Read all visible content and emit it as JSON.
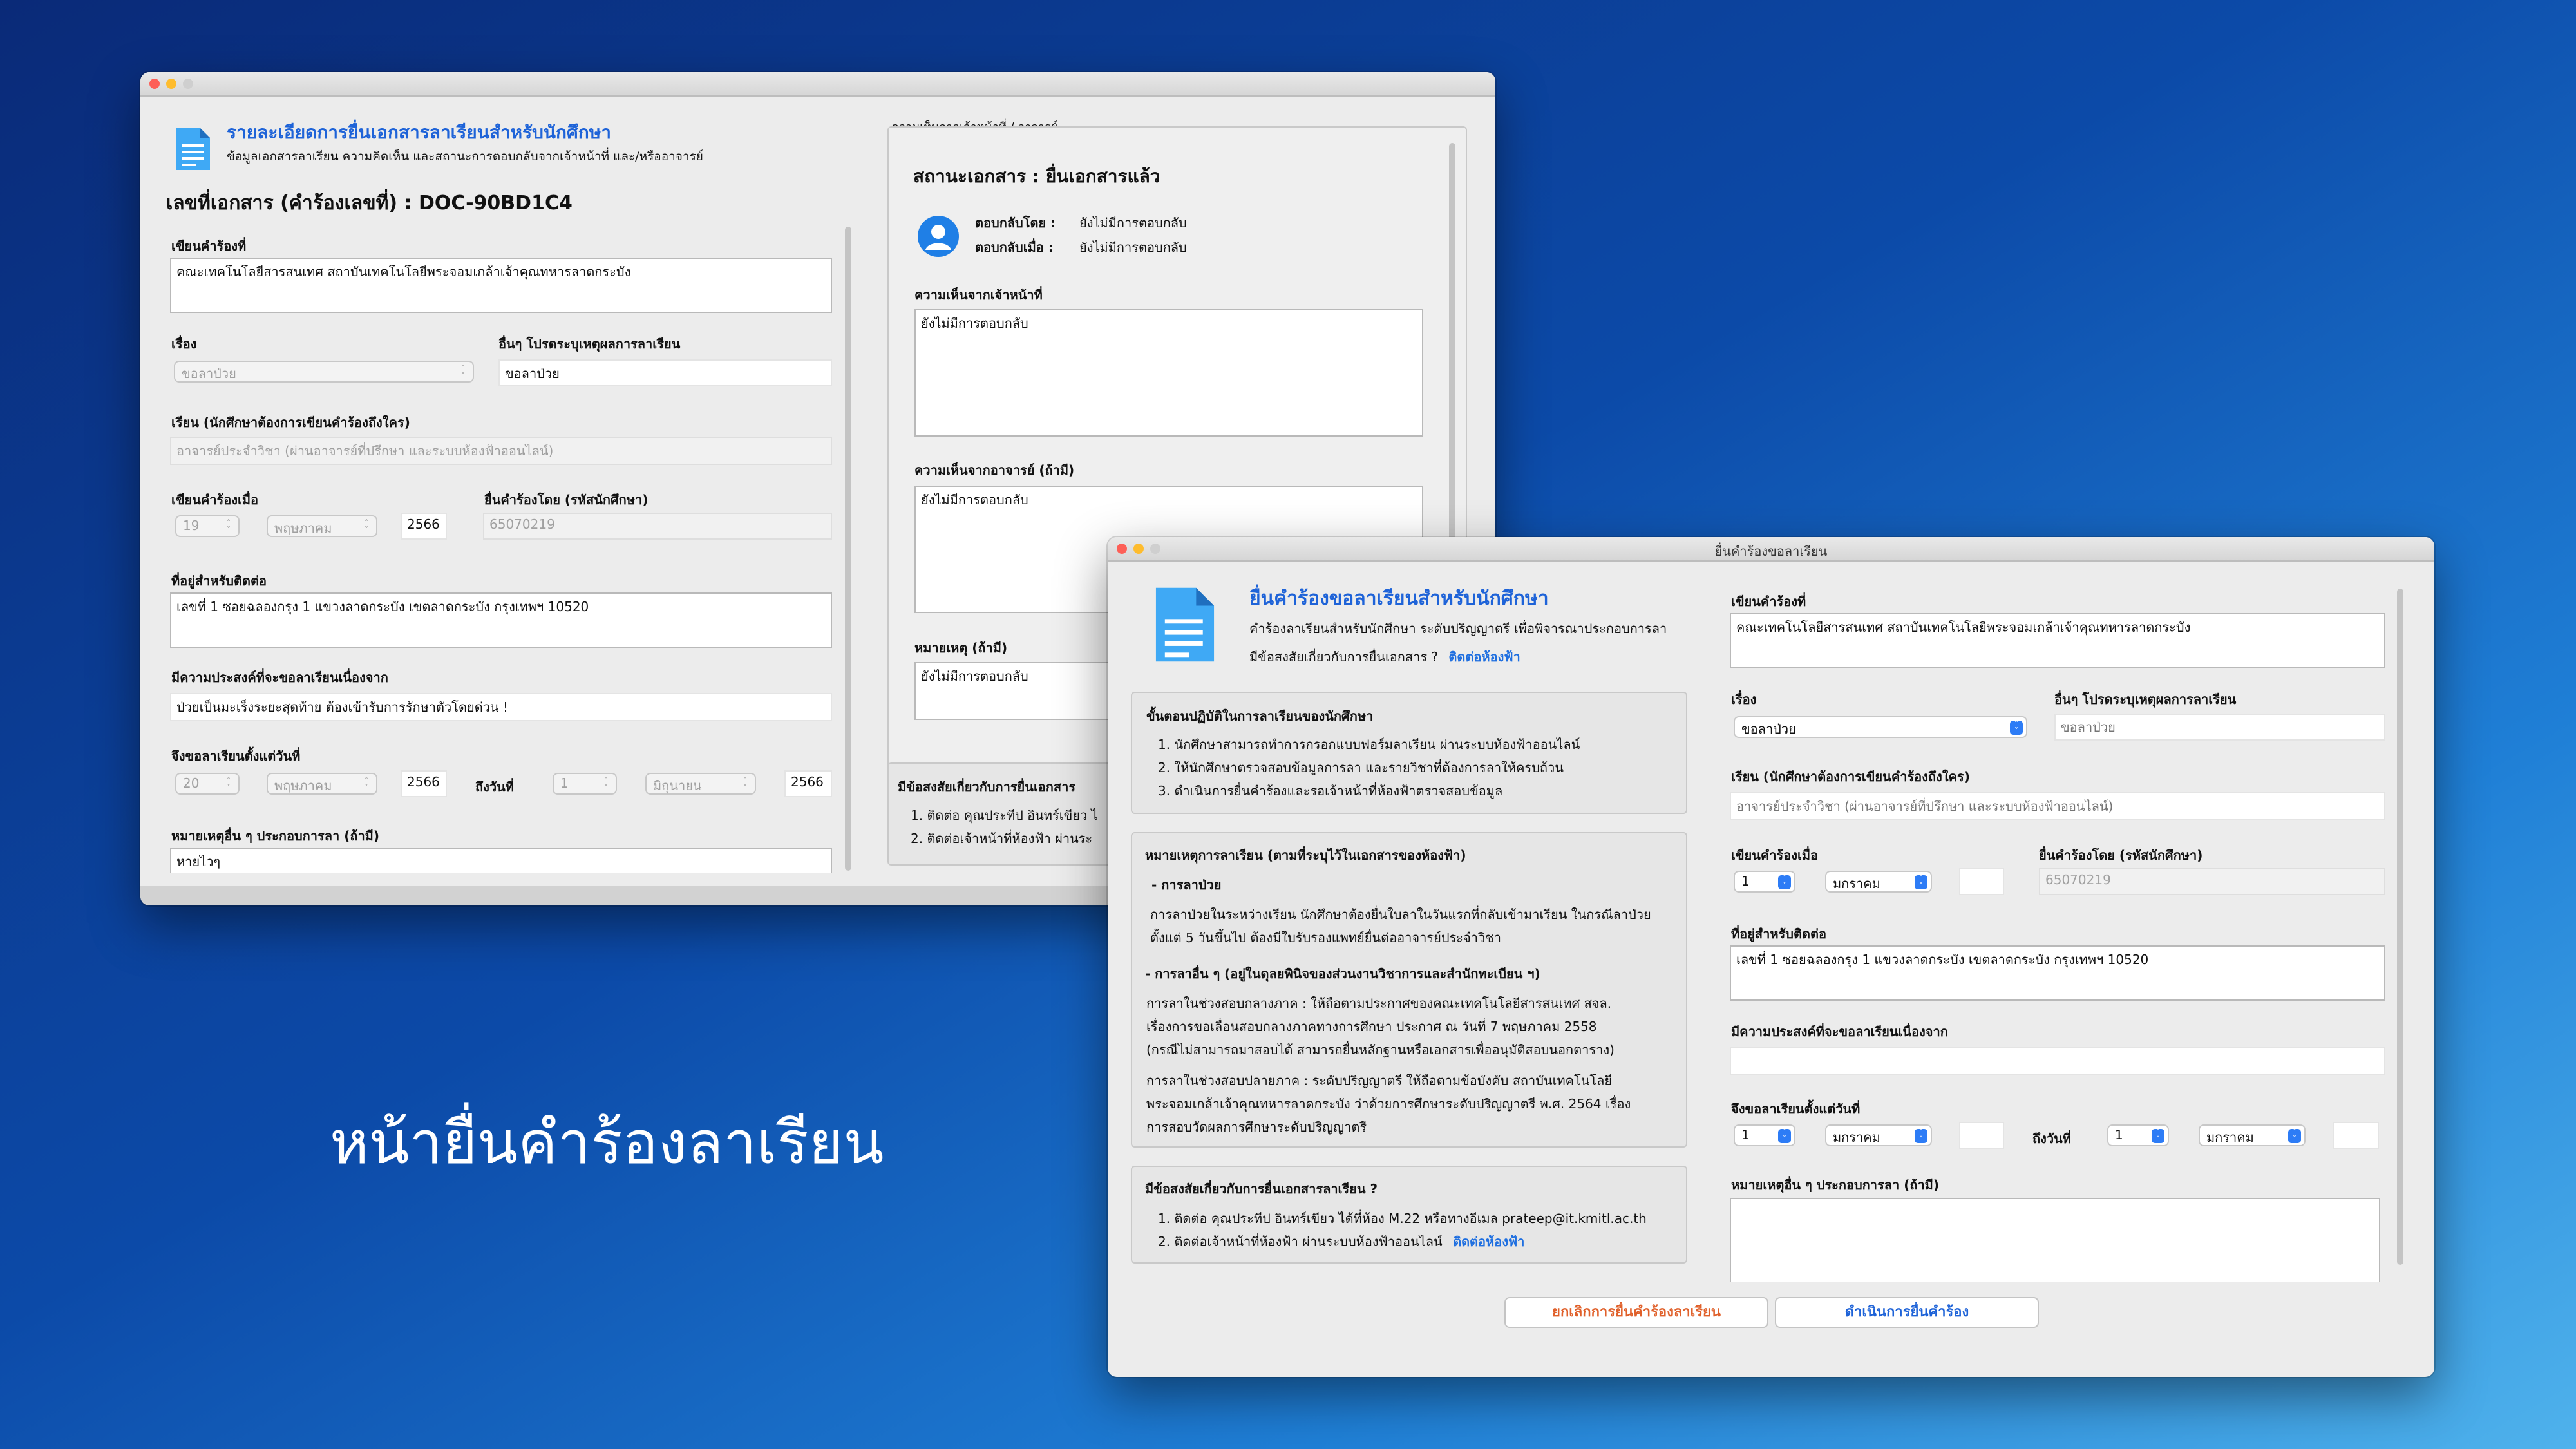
{
  "hero": {
    "text": "หน้ายื่นคำร้องลาเรียน"
  },
  "detail": {
    "title": "รายละเอียดการยื่นเอกสารลาเรียนสำหรับนักศึกษา",
    "subtitle": "ข้อมูลเอกสารลาเรียน ความคิดเห็น และสถานะการตอบกลับจากเจ้าหน้าที่ และ/หรืออาจารย์",
    "doc_id": "เลขที่เอกสาร (คำร้องเลขที่) :  DOC-90BD1C4",
    "write_at_label": "เขียนคำร้องที่",
    "write_at_value": "คณะเทคโนโลยีสารสนเทศ สถาบันเทคโนโลยีพระจอมเกล้าเจ้าคุณทหารลาดกระบัง",
    "subject_label": "เรื่อง",
    "subject_value": "ขอลาป่วย",
    "other_label": "อื่นๆ โปรดระบุเหตุผลการลาเรียน",
    "other_value": "ขอลาป่วย",
    "dear_label": "เรียน (นักศึกษาต้องการเขียนคำร้องถึงใคร)",
    "dear_value": "อาจารย์ประจำวิชา (ผ่านอาจารย์ที่ปรึกษา และระบบห้องฟ้าออนไลน์)",
    "date_label": "เขียนคำร้องเมื่อ",
    "date_day": "19",
    "date_month": "พฤษภาคม",
    "date_year": "2566",
    "by_label": "ยื่นคำร้องโดย (รหัสนักศึกษา)",
    "by_value": "65070219",
    "addr_label": "ที่อยู่สำหรับติดต่อ",
    "addr_value": "เลขที่ 1 ซอยฉลองกรุง 1 แขวงลาดกระบัง เขตลาดกระบัง กรุงเทพฯ 10520",
    "reason_label": "มีความประสงค์ที่จะขอลาเรียนเนื่องจาก",
    "reason_value": "ป่วยเป็นมะเร็งระยะสุดท้าย ต้องเข้ารับการรักษาตัวโดยด่วน !",
    "from_label": "จึงขอลาเรียนตั้งแต่วันที่",
    "from_day": "20",
    "from_month": "พฤษภาคม",
    "from_year": "2566",
    "to_label": "ถึงวันที่",
    "to_day": "1",
    "to_month": "มิถุนายน",
    "to_year": "2566",
    "note_label": "หมายเหตุอื่น ๆ ประกอบการลา (ถ้ามี)",
    "note_value": "หายไวๆ",
    "comment_group": "ความเห็นจากเจ้าหน้าที่ / อาจารย์",
    "status": "สถานะเอกสาร :  ยื่นเอกสารแล้ว",
    "reply_by_label": "ตอบกลับโดย :",
    "reply_by_value": "ยังไม่มีการตอบกลับ",
    "reply_at_label": "ตอบกลับเมื่อ :",
    "reply_at_value": "ยังไม่มีการตอบกลับ",
    "staff_label": "ความเห็นจากเจ้าหน้าที่",
    "staff_value": "ยังไม่มีการตอบกลับ",
    "teacher_label": "ความเห็นจากอาจารย์ (ถ้ามี)",
    "teacher_value": "ยังไม่มีการตอบกลับ",
    "remark_label": "หมายเหตุ (ถ้ามี)",
    "remark_value": "ยังไม่มีการตอบกลับ",
    "faq_title": "มีข้อสงสัยเกี่ยวกับการยื่นเอกสาร",
    "faq_1": "1. ติดต่อ คุณประทีป อินทร์เขียว ไ",
    "faq_2": "2. ติดต่อเจ้าหน้าที่ห้องฟ้า ผ่านระ"
  },
  "form": {
    "window_title": "ยื่นคำร้องขอลาเรียน",
    "title": "ยื่นคำร้องขอลาเรียนสำหรับนักศึกษา",
    "desc": "คำร้องลาเรียนสำหรับนักศึกษา ระดับปริญญาตรี เพื่อพิจารณาประกอบการลา",
    "question": "มีข้อสงสัยเกี่ยวกับการยื่นเอกสาร ?",
    "contact_link": "ติดต่อห้องฟ้า",
    "steps_title": "ขั้นตอนปฏิบัติในการลาเรียนของนักศึกษา",
    "steps": [
      "1. นักศึกษาสามารถทำการกรอกแบบฟอร์มลาเรียน ผ่านระบบห้องฟ้าออนไลน์",
      "2. ให้นักศึกษาตรวจสอบข้อมูลการลา และรายวิชาที่ต้องการลาให้ครบถ้วน",
      "3. ดำเนินการยื่นคำร้องและรอเจ้าหน้าที่ห้องฟ้าตรวจสอบข้อมูล"
    ],
    "notes_title": "หมายเหตุการลาเรียน (ตามที่ระบุไว้ในเอกสารของห้องฟ้า)",
    "sick_title": "- การลาป่วย",
    "sick_1": "การลาป่วยในระหว่างเรียน นักศึกษาต้องยื่นใบลาในวันแรกที่กลับเข้ามาเรียน ในกรณีลาป่วย",
    "sick_2": "ตั้งแต่ 5 วันขึ้นไป ต้องมีใบรับรองแพทย์ยื่นต่ออาจารย์ประจำวิชา",
    "other_title": "- การลาอื่น ๆ (อยู่ในดุลยพินิจของส่วนงานวิชาการและสำนักทะเบียน ฯ)",
    "other_1": "การลาในช่วงสอบกลางภาค : ให้ถือตามประกาศของคณะเทคโนโลยีสารสนเทศ สจล.",
    "other_2": "เรื่องการขอเลื่อนสอบกลางภาคทางการศึกษา ประกาศ ณ วันที่ 7 พฤษภาคม 2558",
    "other_3": "(กรณีไม่สามารถมาสอบได้ สามารถยื่นหลักฐานหรือเอกสารเพื่ออนุมัติสอบนอกตาราง)",
    "other_4": "การลาในช่วงสอบปลายภาค : ระดับปริญญาตรี ให้ถือตามข้อบังคับ สถาบันเทคโนโลยี",
    "other_5": "พระจอมเกล้าเจ้าคุณทหารลาดกระบัง ว่าด้วยการศึกษาระดับปริญญาตรี พ.ศ. 2564 เรื่อง",
    "other_6": "การสอบวัดผลการศึกษาระดับปริญญาตรี",
    "faq_title": "มีข้อสงสัยเกี่ยวกับการยื่นเอกสารลาเรียน ?",
    "faq_1": "1. ติดต่อ คุณประทีป อินทร์เขียว ได้ที่ห้อง M.22 หรือทางอีเมล prateep@it.kmitl.ac.th",
    "faq_2": "2. ติดต่อเจ้าหน้าที่ห้องฟ้า ผ่านระบบห้องฟ้าออนไลน์",
    "faq_2_link": "ติดต่อห้องฟ้า",
    "write_at_label": "เขียนคำร้องที่",
    "write_at_value": "คณะเทคโนโลยีสารสนเทศ สถาบันเทคโนโลยีพระจอมเกล้าเจ้าคุณทหารลาดกระบัง",
    "subject_label": "เรื่อง",
    "subject_value": "ขอลาป่วย",
    "other_label": "อื่นๆ โปรดระบุเหตุผลการลาเรียน",
    "other_placeholder": "ขอลาป่วย",
    "dear_label": "เรียน (นักศึกษาต้องการเขียนคำร้องถึงใคร)",
    "dear_placeholder": "อาจารย์ประจำวิชา (ผ่านอาจารย์ที่ปรึกษา และระบบห้องฟ้าออนไลน์)",
    "date_label": "เขียนคำร้องเมื่อ",
    "date_day": "1",
    "date_month": "มกราคม",
    "by_label": "ยื่นคำร้องโดย (รหัสนักศึกษา)",
    "by_value": "65070219",
    "addr_label": "ที่อยู่สำหรับติดต่อ",
    "addr_value": "เลขที่ 1 ซอยฉลองกรุง 1 แขวงลาดกระบัง เขตลาดกระบัง กรุงเทพฯ 10520",
    "reason_label": "มีความประสงค์ที่จะขอลาเรียนเนื่องจาก",
    "from_label": "จึงขอลาเรียนตั้งแต่วันที่",
    "from_day": "1",
    "from_month": "มกราคม",
    "to_label": "ถึงวันที่",
    "to_day": "1",
    "to_month": "มกราคม",
    "note_label": "หมายเหตุอื่น ๆ ประกอบการลา (ถ้ามี)",
    "cancel": "ยกเลิกการยื่นคำร้องลาเรียน",
    "submit": "ดำเนินการยื่นคำร้อง"
  },
  "colors": {
    "accent": "#1e63d8",
    "cancel": "#e0602a",
    "submit": "#1e63d8"
  }
}
